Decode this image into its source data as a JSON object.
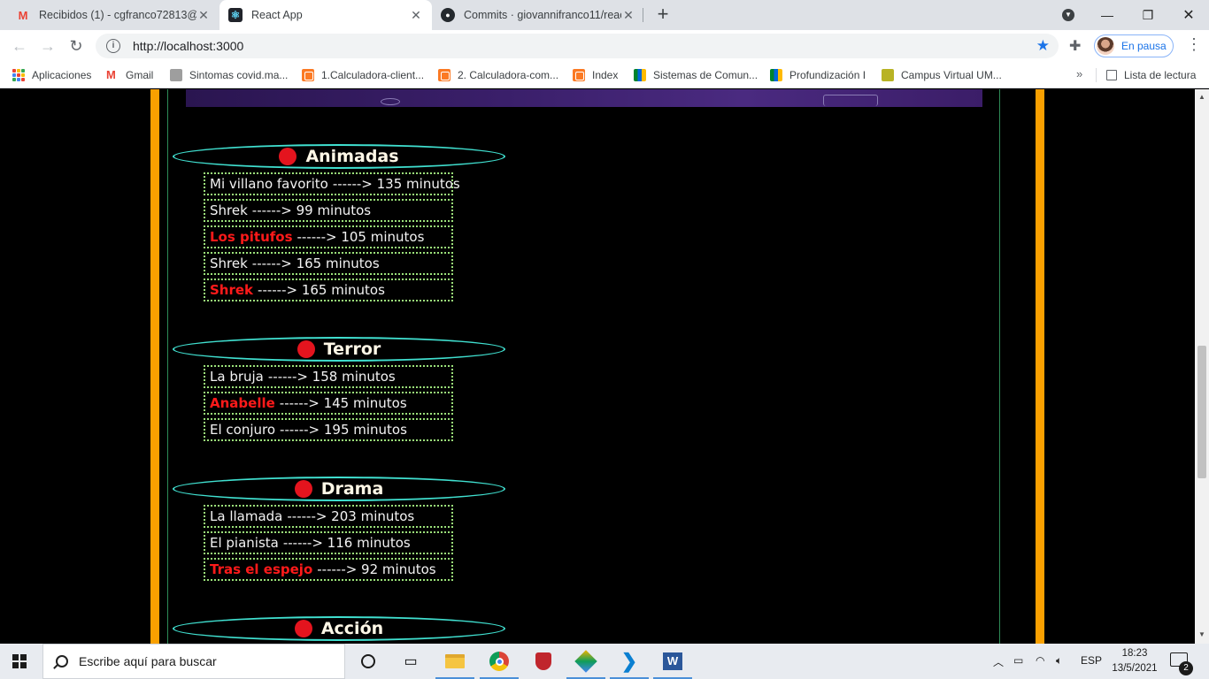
{
  "browser": {
    "tabs": [
      {
        "title": "Recibidos (1) - cgfranco72813@u",
        "icon": "gmail-icon",
        "active": false
      },
      {
        "title": "React App",
        "icon": "react-icon",
        "active": true
      },
      {
        "title": "Commits · giovannifranco11/reac",
        "icon": "github-icon",
        "active": false
      }
    ],
    "new_tab": "+",
    "url": "http://localhost:3000",
    "profile_label": "En pausa"
  },
  "bookmarks": [
    {
      "label": "Aplicaciones",
      "icon": "apps-grid-icon"
    },
    {
      "label": "Gmail",
      "icon": "gmail-icon"
    },
    {
      "label": "Sintomas covid.ma...",
      "icon": "covid-icon"
    },
    {
      "label": "1.Calculadora-client...",
      "icon": "xampp-icon"
    },
    {
      "label": "2. Calculadora-com...",
      "icon": "xampp-icon"
    },
    {
      "label": "Index",
      "icon": "xampp-icon"
    },
    {
      "label": "Sistemas de Comun...",
      "icon": "google-meet-icon"
    },
    {
      "label": "Profundización I",
      "icon": "google-meet-icon"
    },
    {
      "label": "Campus Virtual UM...",
      "icon": "moodle-icon"
    }
  ],
  "reading_list": "Lista de lectura",
  "page": {
    "categories": [
      {
        "name": "Animadas",
        "movies": [
          {
            "title": "Mi villano favorito",
            "suffix": "------> 135 minutos",
            "highlight": false
          },
          {
            "title": "Shrek",
            "suffix": "------> 99 minutos",
            "highlight": false
          },
          {
            "title": "Los pitufos",
            "suffix": "------> 105 minutos",
            "highlight": true
          },
          {
            "title": "Shrek",
            "suffix": "------> 165 minutos",
            "highlight": false
          },
          {
            "title": "Shrek",
            "suffix": "------> 165 minutos",
            "highlight": true
          }
        ]
      },
      {
        "name": "Terror",
        "movies": [
          {
            "title": "La bruja",
            "suffix": "------> 158 minutos",
            "highlight": false
          },
          {
            "title": "Anabelle",
            "suffix": "------> 145 minutos",
            "highlight": true
          },
          {
            "title": "El conjuro",
            "suffix": "------> 195 minutos",
            "highlight": false
          }
        ]
      },
      {
        "name": "Drama",
        "movies": [
          {
            "title": "La llamada",
            "suffix": "------> 203 minutos",
            "highlight": false
          },
          {
            "title": "El pianista",
            "suffix": "------> 116 minutos",
            "highlight": false
          },
          {
            "title": "Tras el espejo",
            "suffix": "------> 92 minutos",
            "highlight": true
          }
        ]
      },
      {
        "name": "Acción",
        "movies": []
      }
    ],
    "colors": {
      "accent_orange": "#f9a000",
      "header_border": "#40e0d0",
      "dot_red": "#e4141e",
      "highlight_red": "#ff1a1a",
      "dotted_green": "#9be27a"
    }
  },
  "taskbar": {
    "search_placeholder": "Escribe aquí para buscar",
    "language": "ESP",
    "time": "18:23",
    "date": "13/5/2021",
    "notification_count": "2"
  }
}
